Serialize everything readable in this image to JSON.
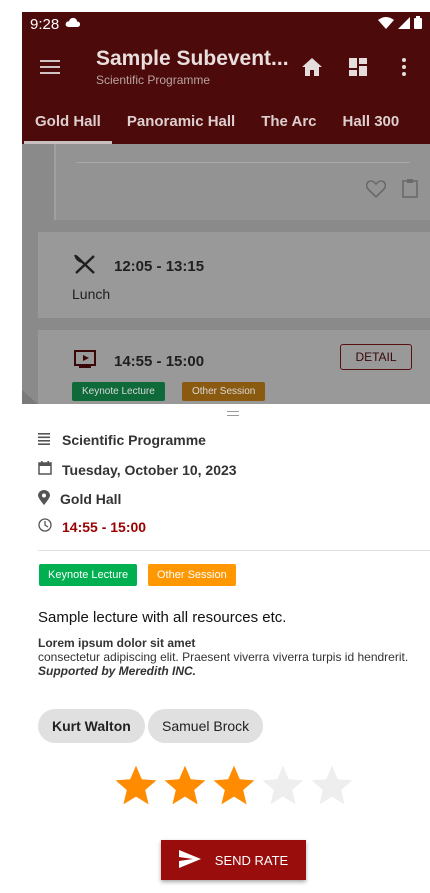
{
  "status_bar": {
    "time": "9:28"
  },
  "app_bar": {
    "title": "Sample Subevent...",
    "subtitle": "Scientific Programme"
  },
  "tabs": [
    {
      "label": "Gold Hall",
      "active": true
    },
    {
      "label": "Panoramic Hall",
      "active": false
    },
    {
      "label": "The Arc",
      "active": false
    },
    {
      "label": "Hall 300",
      "active": false
    }
  ],
  "background_cards": {
    "lunch_time": "12:05 - 13:15",
    "lunch_label": "Lunch",
    "session_time": "14:55 - 15:00",
    "detail_label": "DETAIL",
    "chip1": "Keynote Lecture",
    "chip2": "Other Session"
  },
  "sheet": {
    "programme": "Scientific Programme",
    "date": "Tuesday, October 10, 2023",
    "hall": "Gold Hall",
    "time": "14:55 - 15:00",
    "chips": [
      "Keynote Lecture",
      "Other Session"
    ],
    "lecture_title": "Sample lecture with all resources etc.",
    "desc_heading": "Lorem ipsum dolor sit amet",
    "desc_body": "consectetur adipiscing elit. Praesent viverra viverra turpis id hendrerit. ",
    "desc_sponsor": "Supported by Meredith INC.",
    "speakers": [
      "Kurt Walton",
      "Samuel Brock"
    ],
    "rating": 3,
    "max_rating": 5,
    "send_label": "SEND RATE"
  },
  "colors": {
    "brand_dark": "#4d0a0a",
    "accent_red": "#9a0d0d",
    "star_on": "#ff8c00",
    "star_off": "#eeeeee",
    "chip_green": "#00b050",
    "chip_orange": "#ff9800"
  }
}
